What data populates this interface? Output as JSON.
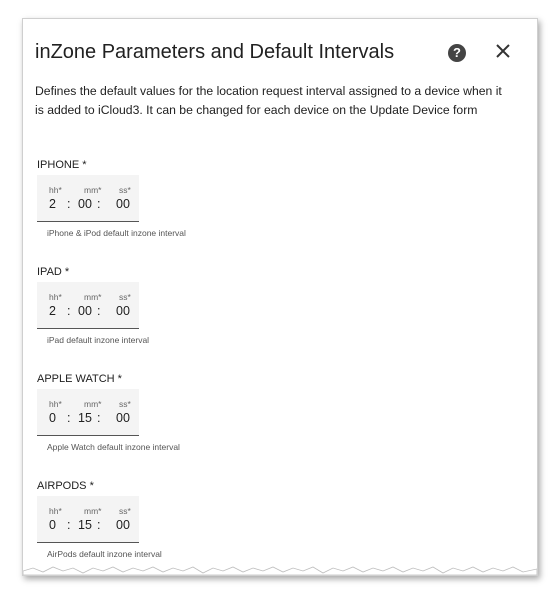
{
  "dialog": {
    "title": "inZone Parameters and Default Intervals",
    "description": "Defines the default values for the location request interval assigned to a device when it is added to iCloud3. It can be changed for each device on the Update Device form",
    "help_glyph": "?",
    "close_glyph": "✕"
  },
  "fields": [
    {
      "label": "IPHONE *",
      "hh_caption": "hh*",
      "mm_caption": "mm*",
      "ss_caption": "ss*",
      "hh": "2",
      "mm": "00",
      "ss": "00",
      "helper": "iPhone & iPod default inzone interval"
    },
    {
      "label": "IPAD *",
      "hh_caption": "hh*",
      "mm_caption": "mm*",
      "ss_caption": "ss*",
      "hh": "2",
      "mm": "00",
      "ss": "00",
      "helper": "iPad default inzone interval"
    },
    {
      "label": "APPLE WATCH *",
      "hh_caption": "hh*",
      "mm_caption": "mm*",
      "ss_caption": "ss*",
      "hh": "0",
      "mm": "15",
      "ss": "00",
      "helper": "Apple Watch default inzone interval"
    },
    {
      "label": "AIRPODS *",
      "hh_caption": "hh*",
      "mm_caption": "mm*",
      "ss_caption": "ss*",
      "hh": "0",
      "mm": "15",
      "ss": "00",
      "helper": "AirPods default inzone interval"
    }
  ],
  "separator": ":"
}
